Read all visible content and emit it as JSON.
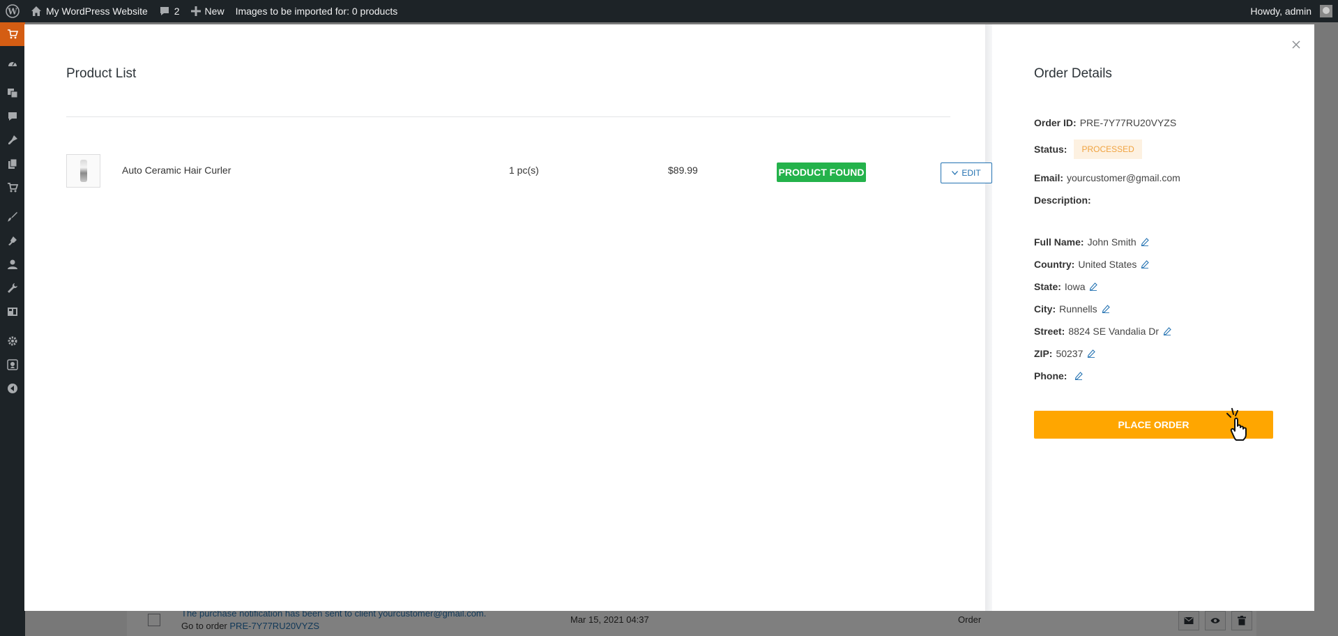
{
  "admin_bar": {
    "site_name": "My WordPress Website",
    "comments_count": "2",
    "new_label": "New",
    "import_status": "Images to be imported for: 0 products",
    "greeting": "Howdy, admin"
  },
  "side_menu": {
    "icons": [
      "aliexpress-plugin-icon",
      "dashboard-icon",
      "media-icon",
      "comments-icon",
      "posts-icon",
      "pages-icon",
      "woocommerce-icon",
      "appearance-icon",
      "plugins-icon",
      "users-icon",
      "tools-icon",
      "settings-grid-icon",
      "settings-icon",
      "location-icon",
      "collapse-icon"
    ]
  },
  "product_list": {
    "title": "Product List",
    "items": [
      {
        "name": "Auto Ceramic Hair Curler",
        "quantity": "1 pc(s)",
        "price": "$89.99",
        "status": "PRODUCT FOUND",
        "edit_label": "EDIT"
      }
    ]
  },
  "order_details": {
    "title": "Order Details",
    "order_id_label": "Order ID:",
    "order_id": "PRE-7Y77RU20VYZS",
    "status_label": "Status:",
    "status": "PROCESSED",
    "email_label": "Email:",
    "email": "yourcustomer@gmail.com",
    "description_label": "Description:",
    "full_name_label": "Full Name:",
    "full_name": "John Smith",
    "country_label": "Country:",
    "country": "United States",
    "state_label": "State:",
    "state": "Iowa",
    "city_label": "City:",
    "city": "Runnells",
    "street_label": "Street:",
    "street": "8824 SE Vandalia Dr",
    "zip_label": "ZIP:",
    "zip": "50237",
    "phone_label": "Phone:",
    "phone": "",
    "place_order_label": "PLACE ORDER"
  },
  "background_row": {
    "message": "The purchase notification has been sent to client yourcustomer@gmail.com.",
    "go_to_order_label": "Go to order",
    "order_link": "PRE-7Y77RU20VYZS",
    "date": "Mar 15, 2021 04:37",
    "type": "Order"
  },
  "colors": {
    "accent_blue": "#2271b1",
    "found_green": "#24b24b",
    "place_order_orange": "#ffa600",
    "status_text": "#f0a340",
    "status_bg": "#fdf1e1",
    "admin_bar": "#1d2327",
    "active_menu": "#d45d13"
  }
}
